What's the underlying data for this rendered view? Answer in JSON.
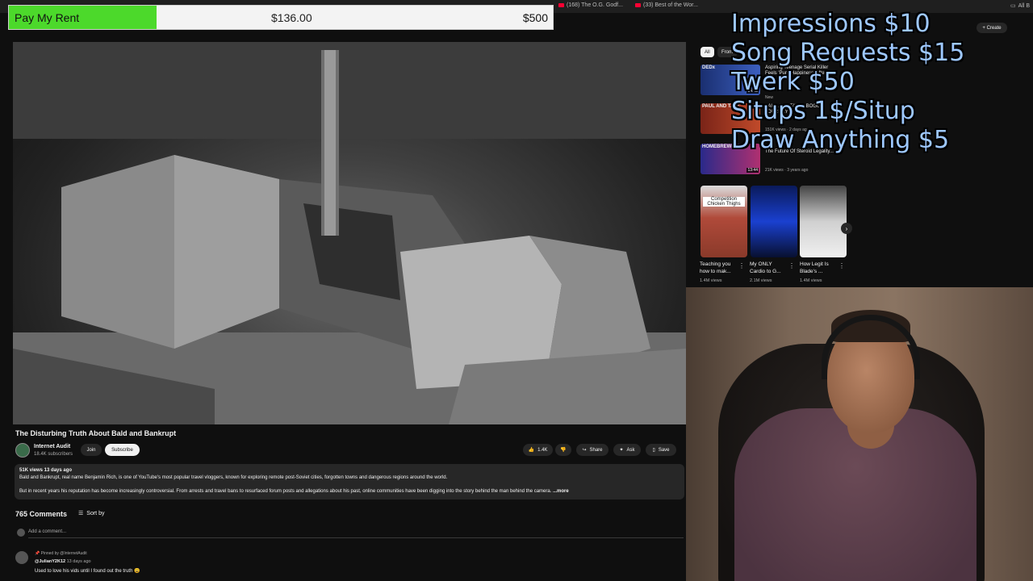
{
  "browser_tabs": [
    {
      "label": "(168) The O.G. Godf..."
    },
    {
      "label": "(33) Best of the Wor..."
    },
    {
      "label": "All B"
    }
  ],
  "donation_goal": {
    "label": "Pay My Rent",
    "amount": "$136.00",
    "target": "$500",
    "progress_fraction": 0.272,
    "fill_color": "#4cd92b"
  },
  "video": {
    "title": "The Disturbing Truth About Bald and Bankrupt",
    "channel": {
      "name": "Internet Audit",
      "subscribers": "18.4K subscribers"
    },
    "join_label": "Join",
    "subscribe_label": "Subscribe",
    "actions": {
      "likes": "1.4K",
      "share": "Share",
      "ask": "Ask",
      "save": "Save"
    },
    "description": {
      "meta": "51K views  13 days ago",
      "line1": "Bald and Bankrupt, real name Benjamin Rich, is one of YouTube's most popular travel vloggers, known for exploring remote post-Soviet cities, forgotten towns and dangerous regions around the world.",
      "line2": "But in recent years his reputation has become increasingly controversial. From arrests and travel bans to resurfaced forum posts and allegations about his past, online communities have been digging into the story behind the man behind the camera.",
      "more": "...more"
    }
  },
  "comments": {
    "count": "765 Comments",
    "sort_label": "Sort by",
    "add_placeholder": "Add a comment...",
    "items": [
      {
        "pinned": "Pinned by @InternetAudit",
        "author": "@JulianY2K12",
        "time": "13 days ago",
        "text": "Used to love his vids until I found out the truth 😩"
      }
    ]
  },
  "sidebar": {
    "create_label": "Create",
    "chips": [
      {
        "label": "All"
      },
      {
        "label": "From"
      }
    ],
    "recommendations": [
      {
        "channel_badge": "DEDx",
        "title": "Aspiring Teenage Serial Killer Feels 'Pure Happiness' After...",
        "meta": "New",
        "duration": "14:45"
      },
      {
        "channel_badge": "PAUL AND TATE",
        "title": "PAUL AND TATES BOGUS JOURNEY",
        "meta": "151K views · 2 days ago",
        "duration": ""
      },
      {
        "channel_badge": "HOMEBREWING",
        "title": "The Future Of Steroid Legality...",
        "meta": "21K views · 3 years ago",
        "duration": "13:44"
      }
    ],
    "shorts": [
      {
        "overlay": "Competition Chicken Thighs",
        "title": "Teaching you how to mak...",
        "views": "1.4M views"
      },
      {
        "overlay": "",
        "title": "My ONLY Cardio to G...",
        "views": "2.1M views"
      },
      {
        "overlay": "",
        "title": "How Legit Is Blade's ...",
        "views": "1.4M views"
      }
    ]
  },
  "price_list": {
    "items": [
      "Impressions $10",
      "Song Requests $15",
      "Twerk $50",
      "Situps 1$/Situp",
      "Draw Anything $5"
    ],
    "color": "#9ec8ff"
  }
}
